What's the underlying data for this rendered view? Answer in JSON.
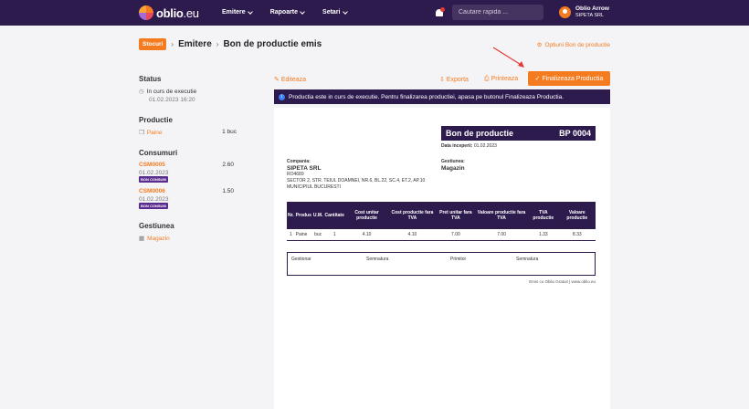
{
  "header": {
    "logo_text": "oblio",
    "logo_suffix": ".eu",
    "nav": [
      "Emitere",
      "Rapoarte",
      "Setari"
    ],
    "search_placeholder": "Cautare rapida ...",
    "user_name": "Oblio Arrow",
    "user_company": "SIPETA SRL",
    "bell_badge": "1",
    "colors": {
      "topbar": "#2d1b4e",
      "accent": "#f47b20"
    }
  },
  "breadcrumb": {
    "root": "Stocuri",
    "middle": "Emitere",
    "current": "Bon de productie emis"
  },
  "options_link": "Optiuni Bon de productie",
  "sidebar": {
    "status_title": "Status",
    "status_value": "In curs de executie",
    "status_date": "01.02.2023 16:20",
    "productie_title": "Productie",
    "productie_item": "Paine",
    "productie_qty": "1 buc",
    "consumuri_title": "Consumuri",
    "consumuri": [
      {
        "code": "CSM0005",
        "value": "2.60",
        "date": "01.02.2023",
        "tag": "BON CONSUM"
      },
      {
        "code": "CSM0006",
        "value": "1.50",
        "date": "01.02.2023",
        "tag": "BON CONSUM"
      }
    ],
    "gestiunea_title": "Gestiunea",
    "gestiunea_value": "Magazin"
  },
  "toolbar": {
    "edit": "Editeaza",
    "export": "Exporta",
    "print": "Printeaza",
    "finalize": "Finalizeaza Productia"
  },
  "alert": "Productia este in curs de executie. Pentru finalizarea productiei, apasa pe butonul Finalizeaza Productia.",
  "document": {
    "title": "Bon de productie",
    "number": "BP 0004",
    "date_label": "Data inceperii:",
    "date_value": "01.02.2023",
    "company_label": "Compania:",
    "company_name": "SIPETA SRL",
    "company_code": "RO4689",
    "company_addr": "SECTOR 2, STR. TEIUL DOAMNEI, NR.6, BL.22, SC.4, ET.2, AP.10",
    "company_city": "MUNICIPIUL BUCURESTI",
    "gestiune_label": "Gestiunea:",
    "gestiune_value": "Magazin",
    "columns": [
      "Nr.",
      "Produs",
      "U.M.",
      "Cantitate",
      "Cost unitar productie",
      "Cost productie fara TVA",
      "Pret unitar fara TVA",
      "Valoare productie fara TVA",
      "TVA productie",
      "Valoare productie"
    ],
    "rows": [
      [
        "1",
        "Paine",
        "buc",
        "1",
        "4.10",
        "4.10",
        "7.00",
        "7.00",
        "1.33",
        "8.33"
      ]
    ],
    "signatures": [
      "Gestionar",
      "Semnatura",
      "Primitor",
      "Semnatura"
    ],
    "footer": "Emis cu Oblio Gratuit | www.oblio.eu"
  }
}
